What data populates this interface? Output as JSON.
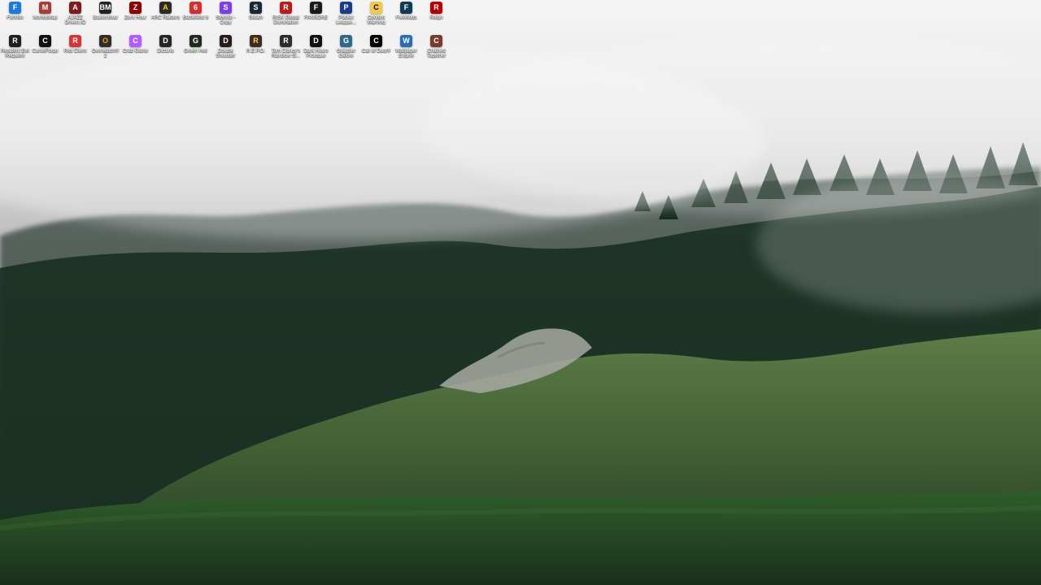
{
  "desktop": {
    "icons": [
      {
        "label": "Fortnite",
        "glyph": "F",
        "bg": "#1d7bd6",
        "fg": "#ffffff"
      },
      {
        "label": "MoneyMap",
        "glyph": "M",
        "bg": "#a63d3d",
        "fg": "#ffffff"
      },
      {
        "label": "AJAZZ Driven.IO",
        "glyph": "A",
        "bg": "#7f1d1d",
        "fg": "#ffffff"
      },
      {
        "label": "BalkenMod",
        "glyph": "BM",
        "bg": "#222222",
        "fg": "#ffffff"
      },
      {
        "label": "Zero Hour",
        "glyph": "Z",
        "bg": "#8b0000",
        "fg": "#ffffff"
      },
      {
        "label": "ARC Raiders",
        "glyph": "A",
        "bg": "#2b2b2b",
        "fg": "#ffcc00"
      },
      {
        "label": "Battlefield 6",
        "glyph": "6",
        "bg": "#d32f2f",
        "fg": "#ffffff"
      },
      {
        "label": "Stremio - Copy",
        "glyph": "S",
        "bg": "#7b3fe4",
        "fg": "#ffffff"
      },
      {
        "label": "Steam",
        "glyph": "S",
        "bg": "#1b2838",
        "fg": "#ffffff"
      },
      {
        "label": "RISK Global Domination",
        "glyph": "R",
        "bg": "#b71c1c",
        "fg": "#ffffff"
      },
      {
        "label": "FANSORE",
        "glyph": "F",
        "bg": "#1a1a1a",
        "fg": "#ffffff"
      },
      {
        "label": "Pocket League...",
        "glyph": "P",
        "bg": "#1e3a8a",
        "fg": "#ffffff"
      },
      {
        "label": "Content Warning",
        "glyph": "C",
        "bg": "#f2c94c",
        "fg": "#000000"
      },
      {
        "label": "FiveMods",
        "glyph": "F",
        "bg": "#0f3b57",
        "fg": "#ffffff"
      },
      {
        "label": "Reign",
        "glyph": "R",
        "bg": "#b30000",
        "fg": "#ffffff"
      },
      {
        "label": "Resident Evil Requiem",
        "glyph": "R",
        "bg": "#1f1f1f",
        "fg": "#ffffff"
      },
      {
        "label": "CurseForge",
        "glyph": "C",
        "bg": "#111111",
        "fg": "#ffffff"
      },
      {
        "label": "Riot Client",
        "glyph": "R",
        "bg": "#d13639",
        "fg": "#ffffff"
      },
      {
        "label": "Overwatch® 2",
        "glyph": "O",
        "bg": "#2e2e2e",
        "fg": "#f39c12"
      },
      {
        "label": "Crab Game",
        "glyph": "C",
        "bg": "#b05cff",
        "fg": "#ffffff"
      },
      {
        "label": "Dicturio",
        "glyph": "D",
        "bg": "#262626",
        "fg": "#ffffff"
      },
      {
        "label": "Green Hell",
        "glyph": "G",
        "bg": "#1e2b1e",
        "fg": "#ffffff"
      },
      {
        "label": "Double Shoulder",
        "glyph": "D",
        "bg": "#2a1a1a",
        "fg": "#ffffff"
      },
      {
        "label": "R.E.P.O.",
        "glyph": "R",
        "bg": "#3d2b1f",
        "fg": "#ffcc66"
      },
      {
        "label": "Tom Clancy's Rainbow Si...",
        "glyph": "R",
        "bg": "#2c2c2c",
        "fg": "#ffffff"
      },
      {
        "label": "Dark Hours Prologue",
        "glyph": "D",
        "bg": "#101010",
        "fg": "#ffffff"
      },
      {
        "label": "Grappler Galore",
        "glyph": "G",
        "bg": "#2d6a8a",
        "fg": "#ffffff"
      },
      {
        "label": "Call of Duty®",
        "glyph": "C",
        "bg": "#000000",
        "fg": "#ffffff"
      },
      {
        "label": "Wallpaper Engine",
        "glyph": "W",
        "bg": "#2b6cb0",
        "fg": "#ffffff"
      },
      {
        "label": "Chained Together",
        "glyph": "C",
        "bg": "#7a3b2e",
        "fg": "#ffffff"
      }
    ]
  }
}
